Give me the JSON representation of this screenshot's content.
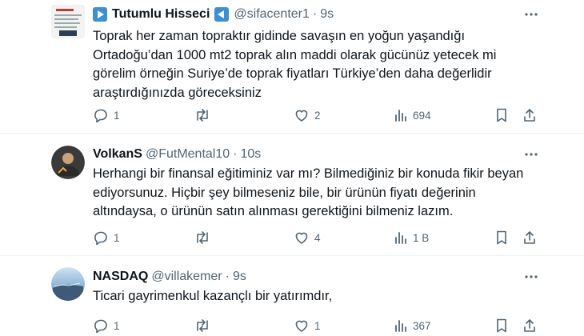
{
  "tweets": [
    {
      "name": "Tutumlu Hisseci",
      "handle": "@sifacenter1",
      "time": "9s",
      "text": [
        "Toprak her zaman topraktır gidinde savaşın en yoğun yaşandığı",
        "Ortadoğu’dan 1000 mt2 toprak alın maddi olarak gücünüz yetecek mi",
        "görelim örneğin Suriye’de toprak fiyatları Türkiye’den daha değerlidir",
        "araştırdığınızda göreceksiniz"
      ],
      "replies": "1",
      "reposts": "",
      "likes": "2",
      "views": "694"
    },
    {
      "name": "VolkanS",
      "handle": "@FutMental10",
      "time": "10s",
      "text": [
        "Herhangi bir finansal eğitiminiz var mı? Bilmediğiniz bir konuda fikir beyan",
        "ediyorsunuz. Hiçbir şey bilmeseniz bile, bir ürünün fiyatı değerinin",
        "altındaysa, o ürünün satın alınması gerektiğini bilmeniz lazım."
      ],
      "replies": "1",
      "reposts": "",
      "likes": "4",
      "views": "1 B"
    },
    {
      "name": "NASDAQ",
      "handle": "@villakemer",
      "time": "9s",
      "text": [
        "Ticari gayrimenkul kazançlı bir yatırımdır,"
      ],
      "replies": "1",
      "reposts": "",
      "likes": "1",
      "views": "367"
    }
  ],
  "separator": "·",
  "colors": {
    "muted": "#536471",
    "text": "#0f1419",
    "badge_blue": "#3b8fd6"
  }
}
